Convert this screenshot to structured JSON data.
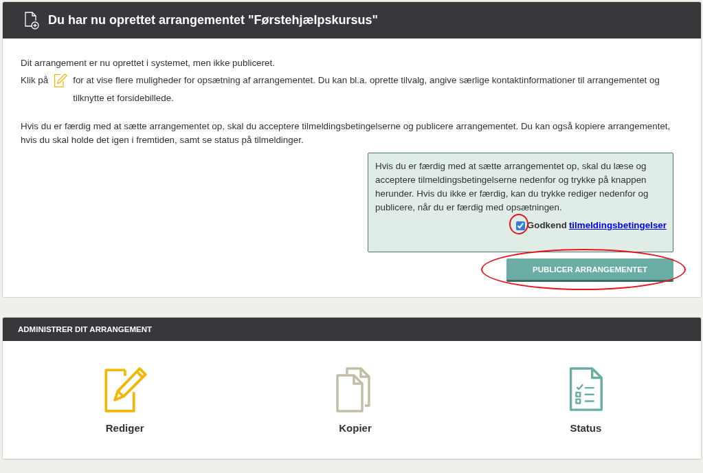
{
  "created_panel": {
    "title": "Du har nu oprettet arrangementet \"Førstehjælpskursus\"",
    "status_text": "Dit arrangement er nu oprettet i systemet, men ikke publiceret.",
    "edit_hint_before": "Klik på",
    "edit_hint_after": "for at vise flere muligheder for opsætning af arrangementet. Du kan bl.a. oprette tilvalg, angive særlige kontaktinformationer til arrangementet og tilknytte et forsidebillede.",
    "publish_info": "Hvis du er færdig med at sætte arrangementet op, skal du acceptere tilmeldingsbetingelserne og publicere arrangementet. Du kan også kopiere arrangementet, hvis du skal holde det igen i fremtiden, samt se status på tilmeldinger.",
    "notice": {
      "text": "Hvis du er færdig med at sætte arrangementet op, skal du læse og acceptere tilmeldingsbetingelserne nedenfor og trykke på knappen herunder. Hvis du ikke er færdig, kan du trykke rediger nedenfor og publicere, når du er færdig med opsætningen.",
      "checkbox": {
        "label": "Godkend",
        "link": "tilmeldingsbetingelser",
        "checked": true,
        "highlighted": true
      }
    },
    "publish_button": {
      "label": "PUBLICER ARRANGEMENTET",
      "highlighted": true
    }
  },
  "admin_panel": {
    "title": "ADMINISTRER DIT ARRANGEMENT",
    "actions": [
      {
        "kind": "edit",
        "label": "Rediger"
      },
      {
        "kind": "copy",
        "label": "Kopier"
      },
      {
        "kind": "status",
        "label": "Status"
      }
    ]
  }
}
